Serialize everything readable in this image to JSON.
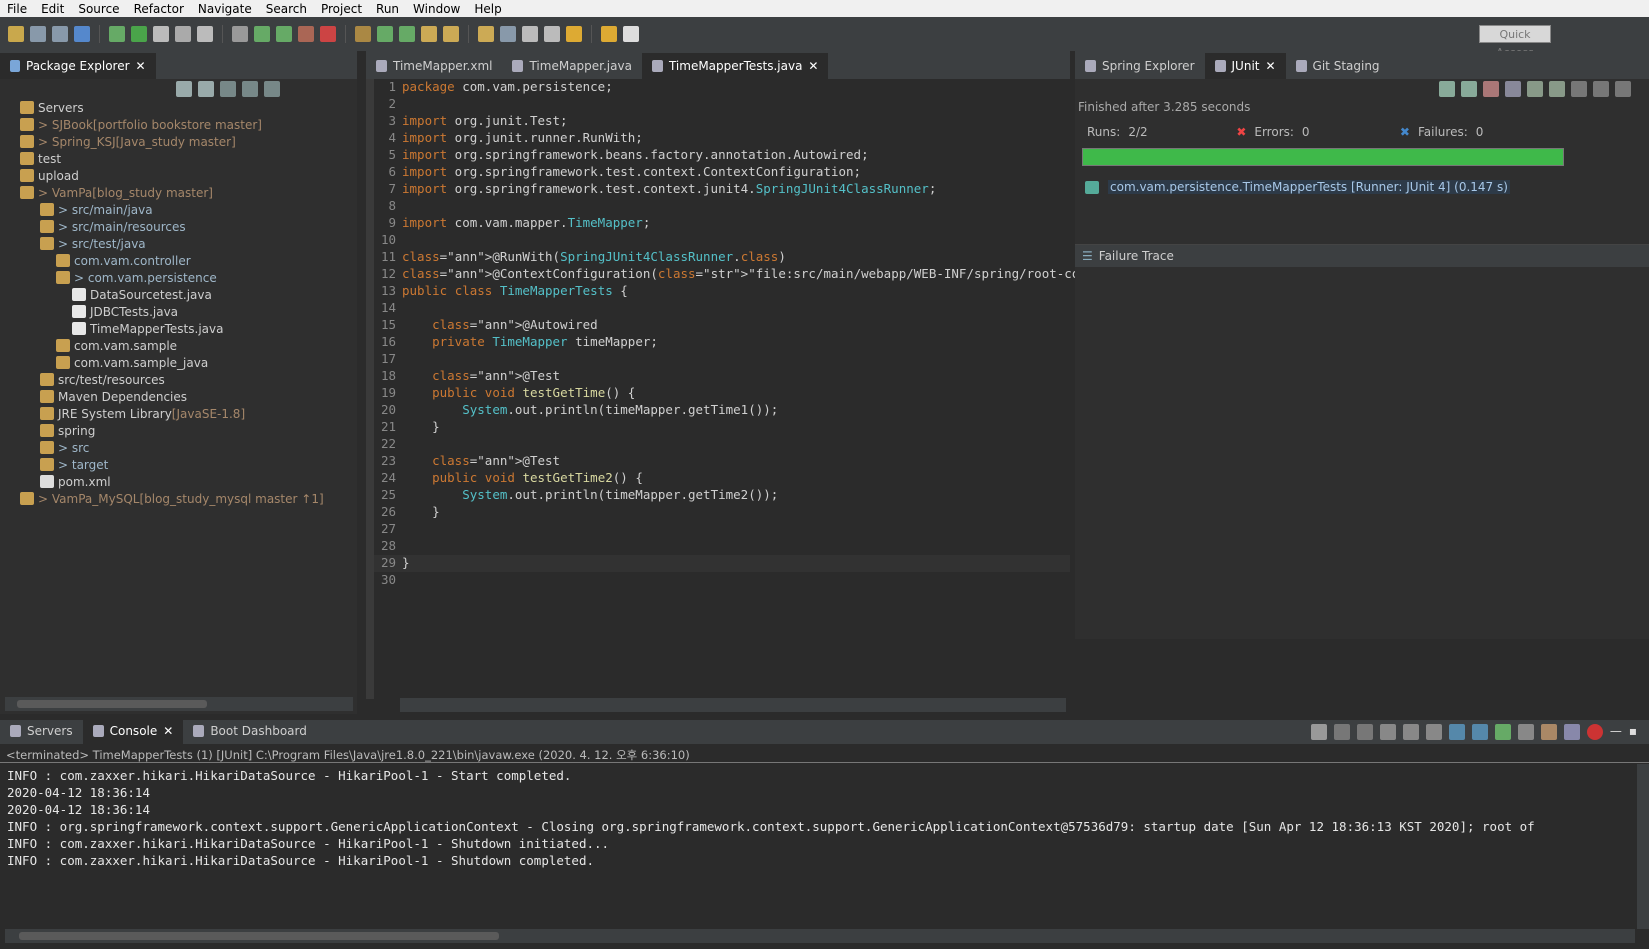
{
  "menu": [
    "File",
    "Edit",
    "Source",
    "Refactor",
    "Navigate",
    "Search",
    "Project",
    "Run",
    "Window",
    "Help"
  ],
  "quick_access": "Quick Access",
  "explorer": {
    "tab": "Package Explorer",
    "items": [
      {
        "label": "Servers",
        "extra": "",
        "cls": ""
      },
      {
        "label": "> SJBook",
        "extra": "[portfolio bookstore master]",
        "cls": "git"
      },
      {
        "label": "> Spring_KSJ",
        "extra": "[Java_study master]",
        "cls": "git"
      },
      {
        "label": "test",
        "extra": "",
        "cls": ""
      },
      {
        "label": "upload",
        "extra": "",
        "cls": ""
      },
      {
        "label": "> VamPa",
        "extra": "[blog_study master]",
        "cls": "git"
      },
      {
        "label": "> src/main/java",
        "extra": "",
        "cls": "pkg"
      },
      {
        "label": "> src/main/resources",
        "extra": "",
        "cls": "pkg"
      },
      {
        "label": "> src/test/java",
        "extra": "",
        "cls": "pkg"
      },
      {
        "label": "com.vam.controller",
        "extra": "",
        "cls": "pkg"
      },
      {
        "label": "> com.vam.persistence",
        "extra": "",
        "cls": "pkg"
      },
      {
        "label": "DataSourcetest.java",
        "extra": "",
        "cls": ""
      },
      {
        "label": "JDBCTests.java",
        "extra": "",
        "cls": ""
      },
      {
        "label": "TimeMapperTests.java",
        "extra": "",
        "cls": ""
      },
      {
        "label": "com.vam.sample",
        "extra": "",
        "cls": ""
      },
      {
        "label": "com.vam.sample_java",
        "extra": "",
        "cls": ""
      },
      {
        "label": "src/test/resources",
        "extra": "",
        "cls": ""
      },
      {
        "label": "Maven Dependencies",
        "extra": "",
        "cls": ""
      },
      {
        "label": "JRE System Library",
        "extra": "[JavaSE-1.8]",
        "cls": ""
      },
      {
        "label": "spring",
        "extra": "",
        "cls": ""
      },
      {
        "label": "> src",
        "extra": "",
        "cls": "pkg"
      },
      {
        "label": "> target",
        "extra": "",
        "cls": "pkg"
      },
      {
        "label": "pom.xml",
        "extra": "",
        "cls": ""
      },
      {
        "label": "> VamPa_MySQL",
        "extra": "[blog_study_mysql master ↑1]",
        "cls": "git"
      }
    ]
  },
  "editor": {
    "tabs": [
      "TimeMapper.xml",
      "TimeMapper.java",
      "TimeMapperTests.java"
    ],
    "lines": [
      "package com.vam.persistence;",
      "",
      "import org.junit.Test;",
      "import org.junit.runner.RunWith;",
      "import org.springframework.beans.factory.annotation.Autowired;",
      "import org.springframework.test.context.ContextConfiguration;",
      "import org.springframework.test.context.junit4.SpringJUnit4ClassRunner;",
      "",
      "import com.vam.mapper.TimeMapper;",
      "",
      "@RunWith(SpringJUnit4ClassRunner.class)",
      "@ContextConfiguration(\"file:src/main/webapp/WEB-INF/spring/root-context.xml\")",
      "public class TimeMapperTests {",
      "",
      "    @Autowired",
      "    private TimeMapper timeMapper;",
      "",
      "    @Test",
      "    public void testGetTime() {",
      "        System.out.println(timeMapper.getTime1());",
      "    }",
      "",
      "    @Test",
      "    public void testGetTime2() {",
      "        System.out.println(timeMapper.getTime2());",
      "    }",
      "",
      "",
      "}",
      ""
    ]
  },
  "junit": {
    "tabs": [
      "Spring Explorer",
      "JUnit",
      "Git Staging"
    ],
    "finished": "Finished after 3.285 seconds",
    "runs_label": "Runs:",
    "runs": "2/2",
    "errors_label": "Errors:",
    "errors": "0",
    "failures_label": "Failures:",
    "failures": "0",
    "progress": 1.0,
    "bar_color": "#3fb94a",
    "test_item": "com.vam.persistence.TimeMapperTests [Runner: JUnit 4] (0.147 s)",
    "failure_trace": "Failure Trace"
  },
  "console": {
    "tabs": [
      "Servers",
      "Console",
      "Boot Dashboard"
    ],
    "header": "<terminated> TimeMapperTests (1) [JUnit] C:\\Program Files\\Java\\jre1.8.0_221\\bin\\javaw.exe (2020. 4. 12. 오후 6:36:10)",
    "lines": [
      "INFO : com.zaxxer.hikari.HikariDataSource - HikariPool-1 - Start completed.",
      "2020-04-12 18:36:14",
      "2020-04-12 18:36:14",
      "INFO : org.springframework.context.support.GenericApplicationContext - Closing org.springframework.context.support.GenericApplicationContext@57536d79: startup date [Sun Apr 12 18:36:13 KST 2020]; root of",
      "INFO : com.zaxxer.hikari.HikariDataSource - HikariPool-1 - Shutdown initiated...",
      "INFO : com.zaxxer.hikari.HikariDataSource - HikariPool-1 - Shutdown completed."
    ]
  }
}
